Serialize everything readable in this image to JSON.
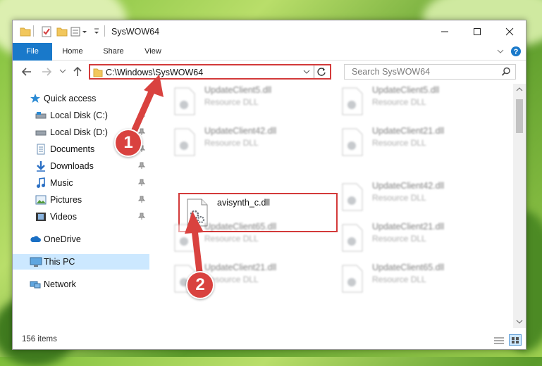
{
  "window": {
    "title": "SysWOW64"
  },
  "ribbon": {
    "tabs": [
      {
        "label": "File"
      },
      {
        "label": "Home"
      },
      {
        "label": "Share"
      },
      {
        "label": "View"
      }
    ]
  },
  "address": {
    "path": "C:\\Windows\\SysWOW64",
    "search_placeholder": "Search SysWOW64"
  },
  "nav": {
    "items": [
      {
        "label": "Quick access",
        "icon": "star-icon"
      },
      {
        "label": "Local Disk (C:)",
        "icon": "drive-icon"
      },
      {
        "label": "Local Disk (D:)",
        "icon": "drive-icon"
      },
      {
        "label": "Documents",
        "icon": "documents-icon"
      },
      {
        "label": "Downloads",
        "icon": "download-icon"
      },
      {
        "label": "Music",
        "icon": "music-icon"
      },
      {
        "label": "Pictures",
        "icon": "pictures-icon"
      },
      {
        "label": "Videos",
        "icon": "videos-icon"
      },
      {
        "label": "OneDrive",
        "icon": "cloud-icon"
      },
      {
        "label": "This PC",
        "icon": "computer-icon"
      },
      {
        "label": "Network",
        "icon": "network-icon"
      }
    ]
  },
  "files": [
    {
      "name": "UpdateClient5.dll",
      "type": "Resource DLL"
    },
    {
      "name": "UpdateClient5.dll",
      "type": "Resource DLL"
    },
    {
      "name": "UpdateClient42.dll",
      "type": "Resource DLL"
    },
    {
      "name": "UpdateClient21.dll",
      "type": "Resource DLL"
    },
    {
      "name": "avisynth_c.dll",
      "type": ""
    },
    {
      "name": "UpdateClient42.dll",
      "type": "Resource DLL"
    },
    {
      "name": "UpdateClient65.dll",
      "type": "Resource DLL"
    },
    {
      "name": "UpdateClient21.dll",
      "type": "Resource DLL"
    },
    {
      "name": "UpdateClient21.dll",
      "type": "Resource DLL"
    },
    {
      "name": "UpdateClient65.dll",
      "type": "Resource DLL"
    }
  ],
  "status": {
    "item_count": "156 items"
  },
  "callouts": [
    {
      "label": "1"
    },
    {
      "label": "2"
    }
  ],
  "colors": {
    "accent": "#1979ca",
    "highlight": "#d33a3a",
    "selected": "#cce8ff"
  }
}
